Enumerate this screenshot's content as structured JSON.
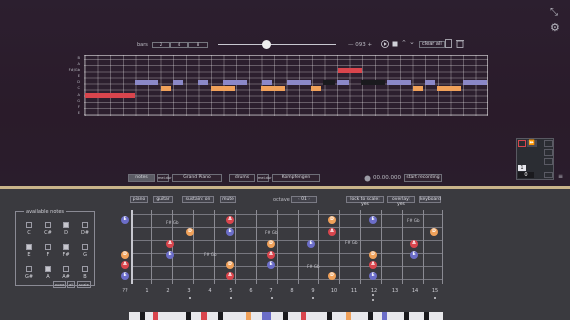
{
  "toolbar": {
    "bars_label": "bars",
    "bars_options": [
      "2",
      "4",
      "8"
    ],
    "tempo_label": "— 093 +",
    "clear_label": "clear all"
  },
  "roll": {
    "row_labels": [
      "B",
      "A",
      "F#/Gb",
      "E",
      "D",
      "C",
      "A",
      "G",
      "F",
      "E"
    ]
  },
  "transport": {
    "notes_tab": "notes",
    "melody_mode": "mel.dur",
    "instrument": "Grand Piano",
    "drums_tab": "drums",
    "drum_mode": "mel.dur",
    "drum_kit": "Kompfengen",
    "time": "00.00.000",
    "record_label": "start recording"
  },
  "mini": {
    "value_top": "1",
    "value_bottom": "0"
  },
  "guitar": {
    "piano_label": "piano",
    "guitar_label": "guitar",
    "sustain_label": "sustain: on",
    "mute_label": "mute",
    "octave_label": "octave",
    "octave_value": "01",
    "lock_label": "lock to scale: yes",
    "overlay_label": "overlay: yes",
    "keyboard_label": "keyboard",
    "available_notes_title": "available notes",
    "note_names": [
      "C",
      "C#",
      "D",
      "D#",
      "E",
      "F",
      "F#",
      "G",
      "G#",
      "A",
      "A#",
      "B"
    ],
    "note_actions": [
      "none",
      "all",
      "scale"
    ],
    "fret_numbers": [
      "1",
      "2",
      "3",
      "4",
      "5",
      "6",
      "7",
      "8",
      "9",
      "10",
      "11",
      "12",
      "13",
      "14",
      "15"
    ],
    "open_label": "??",
    "gb_label": "F# Gb",
    "colors": {
      "A": "#d9454d",
      "E": "#6b6dc8",
      "D": "#f0a15a",
      "marker": "#2b2d35"
    }
  }
}
